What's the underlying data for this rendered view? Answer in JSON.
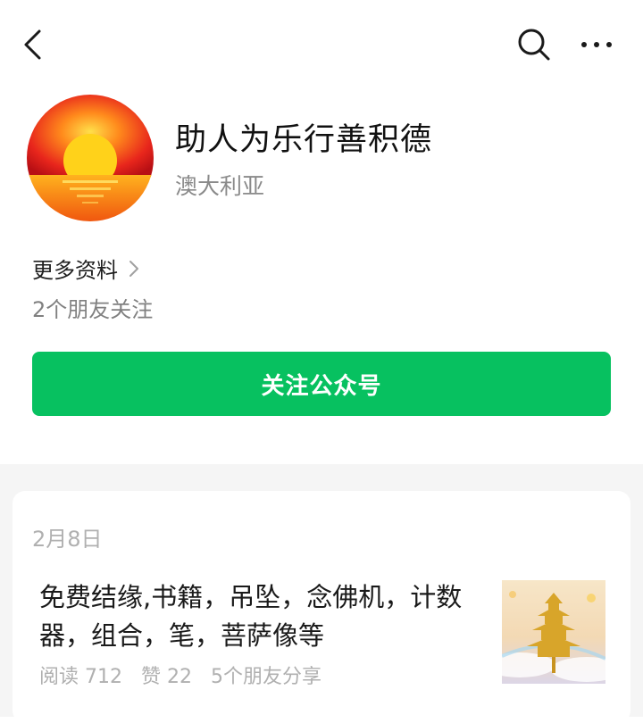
{
  "account": {
    "name": "助人为乐行善积德",
    "region": "澳大利亚",
    "more_info_label": "更多资料",
    "friends_following": "2个朋友关注",
    "follow_button": "关注公众号"
  },
  "article": {
    "date": "2月8日",
    "title": "免费结缘,书籍，吊坠，念佛机，计数器，组合，笔，菩萨像等",
    "reads": "阅读 712",
    "likes": "赞 22",
    "shares": "5个朋友分享"
  },
  "colors": {
    "accent": "#07c160",
    "muted_text": "#8a8a8a",
    "feed_background": "#f5f5f5"
  },
  "icons": [
    "back-arrow-icon",
    "search-icon",
    "more-icon",
    "chevron-right-icon"
  ]
}
